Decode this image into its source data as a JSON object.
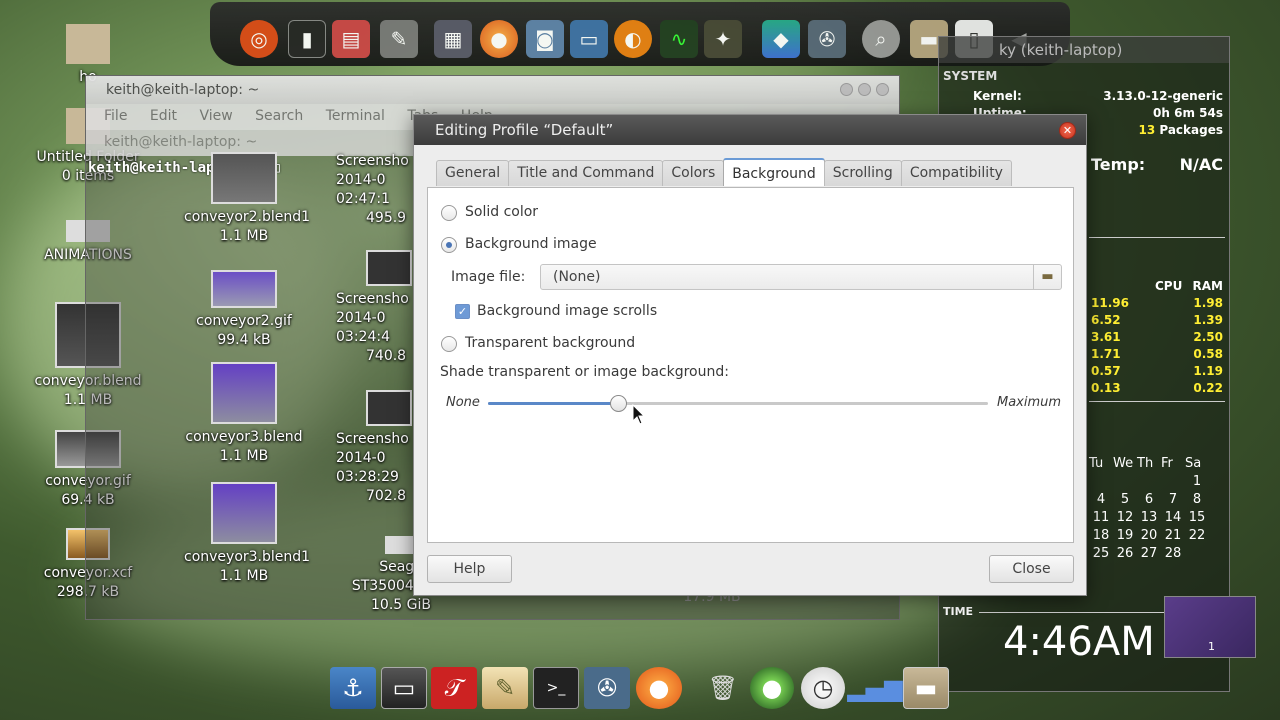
{
  "terminal": {
    "title": "keith@keith-laptop: ~",
    "menu": [
      "File",
      "Edit",
      "View",
      "Search",
      "Terminal",
      "Tabs",
      "Help"
    ],
    "tab_label": "keith@keith-laptop: ~",
    "prompt": "keith@keith-laptop:~$"
  },
  "desktop": {
    "icons": [
      {
        "name": "ho",
        "size": ""
      },
      {
        "name": "Untitled Folder",
        "size": "0 items"
      },
      {
        "name": "ANIMATIONS",
        "size": ""
      },
      {
        "name": "conveyor.blend",
        "size": "1.1 MB"
      },
      {
        "name": "conveyor.gif",
        "size": "69.4 kB"
      },
      {
        "name": "conveyor.xcf",
        "size": "298.7 kB"
      },
      {
        "name": "conveyor2.blend1",
        "size": "1.1 MB"
      },
      {
        "name": "conveyor2.gif",
        "size": "99.4 kB"
      },
      {
        "name": "conveyor3.blend",
        "size": "1.1 MB"
      },
      {
        "name": "conveyor3.blend1",
        "size": "1.1 MB"
      },
      {
        "name": "Screensho 2014-0 02:47:1",
        "size": "495.9"
      },
      {
        "name": "Screensho 2014-0 03:24:4",
        "size": "740.8"
      },
      {
        "name": "Screensho 2014-0 03:28:29",
        "size": "702.8"
      },
      {
        "name": "Seaga ST3500418AS",
        "size": "10.5 GiB"
      }
    ],
    "hidden_size": "17.9 MB"
  },
  "conky": {
    "title": "ky (keith-laptop)",
    "section_system": "SYSTEM",
    "kernel_label": "Kernel:",
    "kernel_value": "3.13.0-12-generic",
    "uptime_label": "Uptime:",
    "uptime_value": "0h 6m 54s",
    "packages_count": "13",
    "packages_label": "Packages",
    "temp_label": "Temp:",
    "temp_value": "N/AC",
    "cpu_header": "CPU",
    "ram_header": "RAM",
    "procs": [
      {
        "cpu": "11.96",
        "ram": "1.98"
      },
      {
        "cpu": "6.52",
        "ram": "1.39"
      },
      {
        "cpu": "3.61",
        "ram": "2.50"
      },
      {
        "cpu": "1.71",
        "ram": "0.58"
      },
      {
        "cpu": "0.57",
        "ram": "1.19"
      },
      {
        "cpu": "0.13",
        "ram": "0.22"
      }
    ],
    "calendar_header": [
      "Tu",
      "We",
      "Th",
      "Fr",
      "Sa"
    ],
    "calendar_rows": [
      [
        "",
        "",
        "",
        "",
        "1"
      ],
      [
        "4",
        "5",
        "6",
        "7",
        "8"
      ],
      [
        "11",
        "12",
        "13",
        "14",
        "15"
      ],
      [
        "18",
        "19",
        "20",
        "21",
        "22"
      ],
      [
        "25",
        "26",
        "27",
        "28",
        ""
      ]
    ],
    "time_label": "TIME",
    "time_value": "4:46AM",
    "workspace_number": "1"
  },
  "dialog": {
    "title": "Editing Profile “Default”",
    "tabs": [
      "General",
      "Title and Command",
      "Colors",
      "Background",
      "Scrolling",
      "Compatibility"
    ],
    "active_tab": "Background",
    "solid_color_label": "Solid color",
    "background_image_label": "Background image",
    "image_file_label": "Image file:",
    "image_file_value": "(None)",
    "scrolls_label": "Background image scrolls",
    "transparent_label": "Transparent background",
    "shade_label": "Shade transparent or image background:",
    "slider_min_label": "None",
    "slider_max_label": "Maximum",
    "slider_value": 0.26,
    "help_label": "Help",
    "close_label": "Close"
  },
  "colors": {
    "accent": "#6b9bd6",
    "conky_highlight": "#ffee33"
  }
}
